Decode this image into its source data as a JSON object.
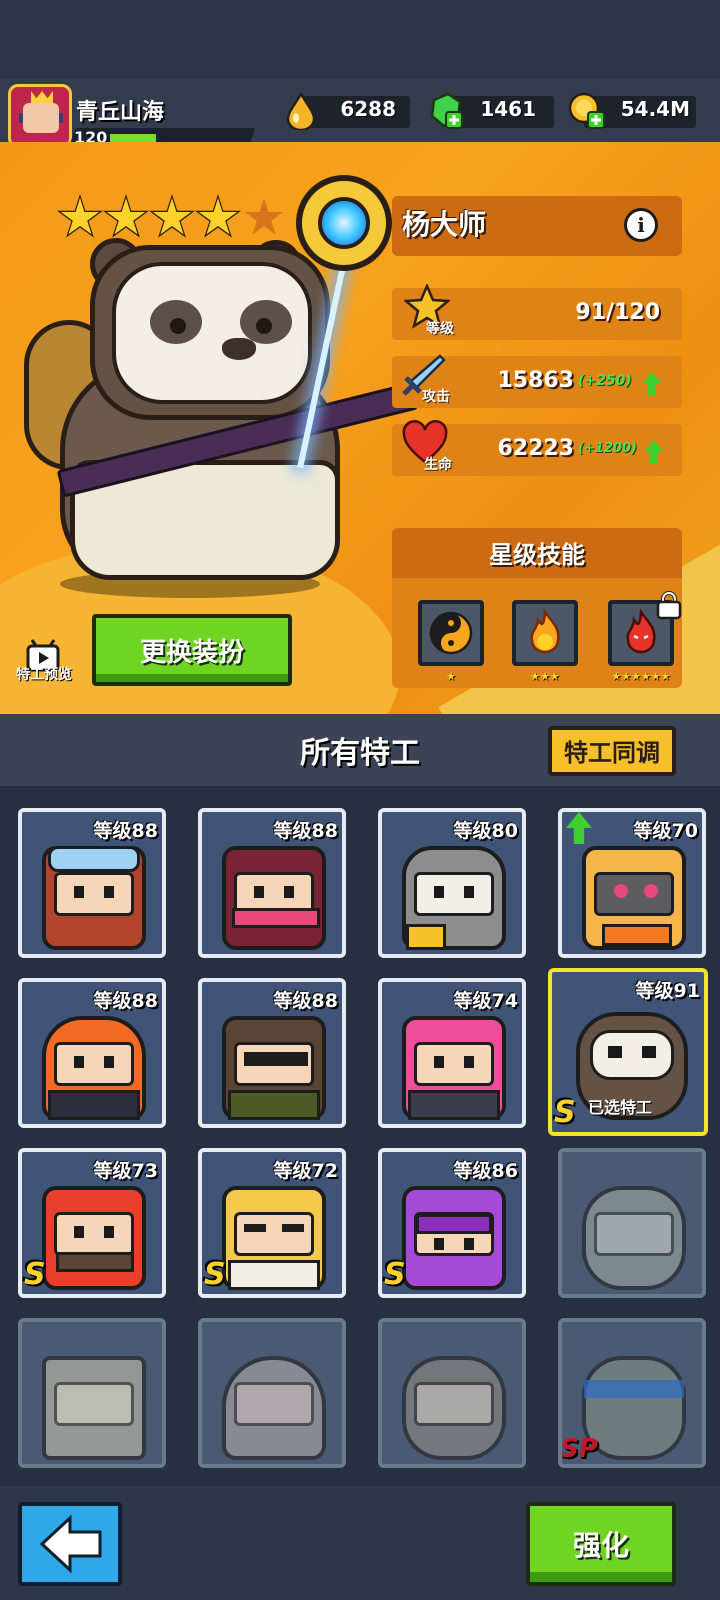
{
  "player": {
    "name": "青丘山海",
    "level": "120"
  },
  "resources": {
    "energy": "6288",
    "gems": "1461",
    "coins": "54.4M"
  },
  "hero": {
    "name": "杨大师",
    "stars_filled": 4,
    "stars_total": 5,
    "level_label": "等级",
    "level_value": "91/120",
    "attack_label": "攻击",
    "attack_value": "15863",
    "attack_bonus": "(+250)",
    "hp_label": "生命",
    "hp_value": "62223",
    "hp_bonus": "(+1200)",
    "info_symbol": "i"
  },
  "star_skills": {
    "title": "星级技能",
    "skills": [
      {
        "icon": "yin-yang-icon",
        "stars": "★"
      },
      {
        "icon": "fire-icon",
        "stars": "★★★"
      },
      {
        "icon": "demon-fire-icon",
        "stars": "★★★★★★",
        "locked": true
      }
    ]
  },
  "buttons": {
    "preview": "特工预览",
    "change_outfit": "更换装扮",
    "sync": "特工同调",
    "strengthen": "强化"
  },
  "roster": {
    "title": "所有特工",
    "cards": [
      {
        "level": "等级88"
      },
      {
        "level": "等级88"
      },
      {
        "level": "等级80"
      },
      {
        "level": "等级70",
        "upgrade": true
      },
      {
        "level": "等级88"
      },
      {
        "level": "等级88"
      },
      {
        "level": "等级74"
      },
      {
        "level": "等级91",
        "selected": true,
        "selected_label": "已选特工",
        "rank": "S"
      },
      {
        "level": "等级73",
        "rank": "S"
      },
      {
        "level": "等级72",
        "rank": "S"
      },
      {
        "level": "等级86",
        "rank": "S"
      },
      {
        "locked": true
      },
      {
        "locked": true
      },
      {
        "locked": true
      },
      {
        "locked": true
      },
      {
        "locked": true,
        "rank": "SP"
      }
    ]
  },
  "colors": {
    "hero_bg": "#f59a18",
    "green_button": "#6fd422",
    "gold": "#ffd22b",
    "selected_border": "#f3e42a"
  }
}
